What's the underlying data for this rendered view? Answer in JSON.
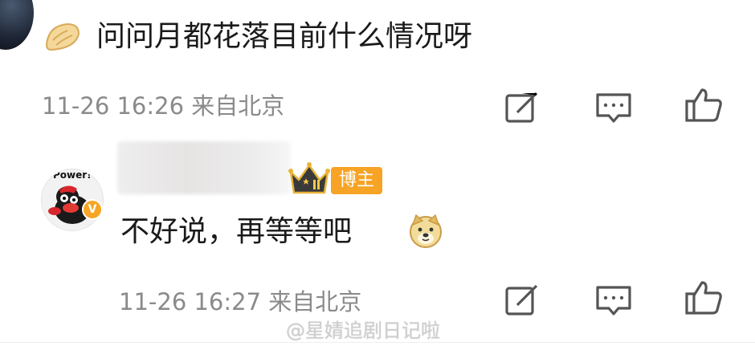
{
  "top_comment": {
    "text": "问问月都花落目前什么情况呀",
    "meta": "11-26 16:26 来自北京"
  },
  "reply": {
    "avatar_text": "Power!",
    "verified_mark": "V",
    "role_badge": "博主",
    "text": "不好说，再等等吧",
    "meta": "11-26 16:27 来自北京"
  },
  "watermark": "@星婧追剧日记啦",
  "icons": {
    "dumpling": "dumpling-emoji-icon",
    "repost": "repost-icon",
    "comment": "comment-icon",
    "like": "like-icon",
    "crown": "crown-level-icon",
    "doge": "doge-emoji-icon"
  },
  "colors": {
    "meta_gray": "#8a8a8a",
    "badge_orange": "#f7a325",
    "icon_gray": "#555555"
  }
}
